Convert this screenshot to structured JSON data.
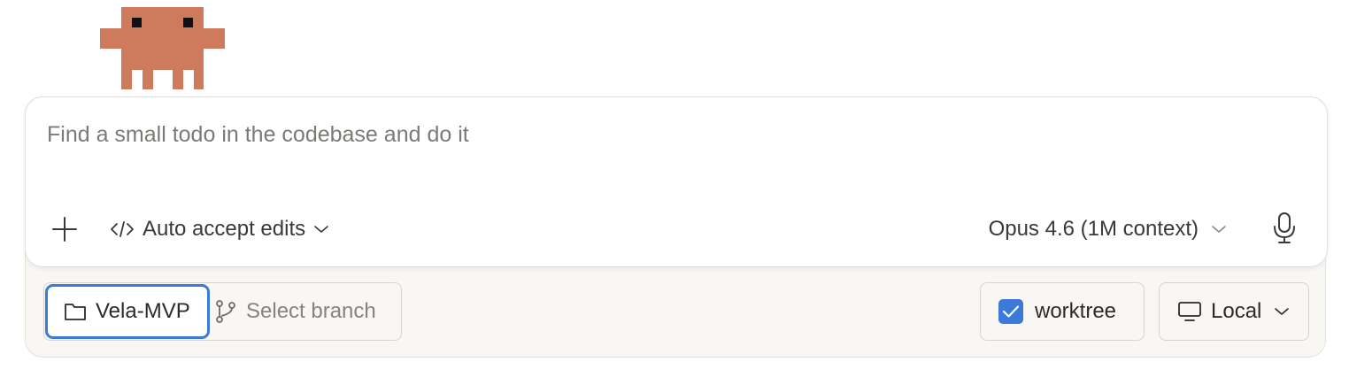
{
  "mascot": {
    "icon": "pixel-crab-mascot-icon",
    "color": "#cd7b5c"
  },
  "prompt": {
    "placeholder": "Find a small todo in the codebase and do it"
  },
  "toolbar": {
    "add_icon": "plus-icon",
    "mode_icon": "code-brackets-icon",
    "mode_label": "Auto accept edits",
    "model_label": "Opus 4.6 (1M context)",
    "mic_icon": "microphone-icon"
  },
  "footer": {
    "folder_label": "Vela-MVP",
    "branch_label": "Select branch",
    "worktree_label": "worktree",
    "worktree_checked": true,
    "environment_label": "Local"
  },
  "colors": {
    "accent": "#3b7ad8",
    "brand": "#cd7b5c"
  }
}
